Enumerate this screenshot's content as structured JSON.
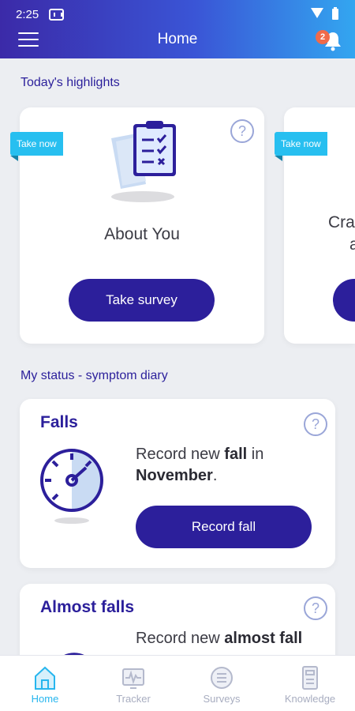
{
  "status_bar": {
    "time": "2:25"
  },
  "header": {
    "title": "Home",
    "notification_count": "2"
  },
  "highlights": {
    "section_title": "Today's highlights",
    "cards": [
      {
        "ribbon": "Take now",
        "title": "About You",
        "button": "Take survey",
        "help": "?"
      },
      {
        "ribbon": "Take now",
        "title_partial_line1": "Cra",
        "title_partial_line2": "a"
      }
    ]
  },
  "diary": {
    "section_title": "My status - symptom diary",
    "cards": [
      {
        "title": "Falls",
        "text_pre": "Record new ",
        "text_bold": "fall",
        "text_mid": " in ",
        "text_month": "November",
        "text_post": ".",
        "button": "Record fall",
        "help": "?"
      },
      {
        "title": "Almost falls",
        "text_pre": "Record new ",
        "text_bold": "almost fall",
        "help": "?"
      }
    ]
  },
  "bottom_nav": {
    "items": [
      {
        "label": "Home",
        "icon": "home-icon",
        "active": true
      },
      {
        "label": "Tracker",
        "icon": "tracker-icon",
        "active": false
      },
      {
        "label": "Surveys",
        "icon": "surveys-icon",
        "active": false
      },
      {
        "label": "Knowledge",
        "icon": "knowledge-icon",
        "active": false
      }
    ]
  },
  "colors": {
    "primary": "#2c1f9b",
    "accent": "#27bff0",
    "badge": "#f06a4a"
  }
}
